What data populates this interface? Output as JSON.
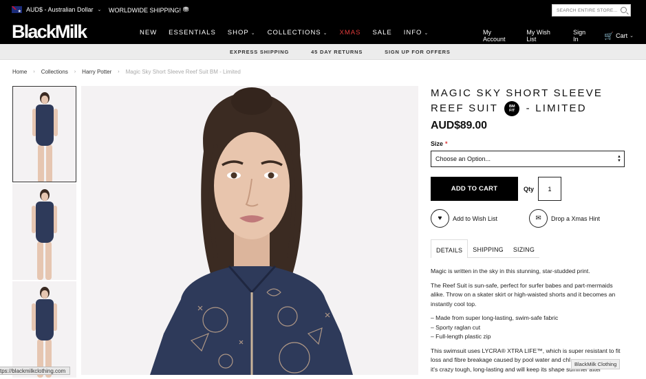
{
  "topbar": {
    "currency": "AUD$ - Australian Dollar",
    "shipping_note": "WORLDWIDE SHIPPING!",
    "search_placeholder": "SEARCH ENTIRE STORE..."
  },
  "logo": "BlackMilk",
  "nav": [
    "NEW",
    "ESSENTIALS",
    "SHOP",
    "COLLECTIONS",
    "XMAS",
    "SALE",
    "INFO"
  ],
  "account": {
    "my_account": "My Account",
    "wish_list": "My Wish List",
    "sign_in": "Sign In",
    "cart": "Cart"
  },
  "promos": [
    "EXPRESS SHIPPING",
    "45 DAY RETURNS",
    "SIGN UP FOR OFFERS"
  ],
  "breadcrumb": [
    "Home",
    "Collections",
    "Harry Potter",
    "Magic Sky Short Sleeve Reef Suit BM - Limited"
  ],
  "product": {
    "title_part1": "MAGIC SKY SHORT SLEEVE REEF SUIT",
    "badge_line1": "BM",
    "badge_line2": "FIT",
    "title_part2": "- LIMITED",
    "price": "AUD$89.00",
    "size_label": "Size",
    "size_required": "*",
    "size_option": "Choose an Option...",
    "add_to_cart": "ADD TO CART",
    "qty_label": "Qty",
    "qty_value": "1",
    "wish_list": "Add to Wish List",
    "xmas_hint": "Drop a Xmas Hint"
  },
  "tabs": [
    "DETAILS",
    "SHIPPING",
    "SIZING"
  ],
  "description": [
    "Magic is written in the sky in this stunning, star-studded print.",
    "The Reef Suit is sun-safe, perfect for surfer babes and part-mermaids alike. Throw on a skater skirt or high-waisted shorts and it becomes an instantly cool top.",
    "– Made from super long-lasting, swim-safe fabric",
    "– Sporty raglan cut",
    "– Full-length plastic zip",
    "This swimsuit uses LYCRA® XTRA LIFE™, which is super resistant to fit loss and fibre breakage caused by pool water and chl",
    "it's crazy tough, long-lasting and will keep its shape summer after"
  ],
  "status_url": "tps://blackmilkclothing.com",
  "tooltip": "BlackMilk Clothing",
  "colors": {
    "topbar_bg": "#000000",
    "xmas_accent": "#e33b3b",
    "promo_bg": "#ececec",
    "button_bg": "#000000",
    "suit_navy": "#2e3a5a"
  }
}
